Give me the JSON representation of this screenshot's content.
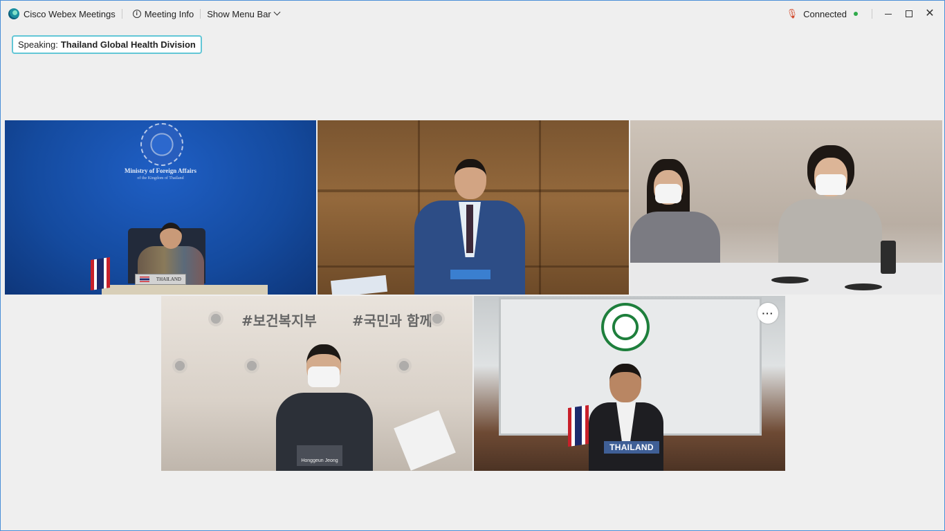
{
  "titlebar": {
    "app_name": "Cisco Webex Meetings",
    "meeting_info_label": "Meeting Info",
    "show_menu_bar_label": "Show Menu Bar",
    "status_label": "Connected"
  },
  "speaking": {
    "prefix": "Speaking:",
    "name": "Thailand Global Health Division"
  },
  "tiles": [
    {
      "backdrop_title": "Ministry of Foreign Affairs",
      "backdrop_subtitle": "of the Kingdom of Thailand",
      "nameplate": "THAILAND"
    },
    {},
    {},
    {
      "banner_left": "#보건복지부",
      "banner_right": "#국민과 함께",
      "nameplate": "Honggeun Jeong"
    },
    {
      "nameplate": "THAILAND",
      "more_label": "···"
    }
  ],
  "colors": {
    "window_border": "#4a8fd8",
    "speaking_border": "#62c6d6",
    "status_dot": "#2faa4a"
  }
}
